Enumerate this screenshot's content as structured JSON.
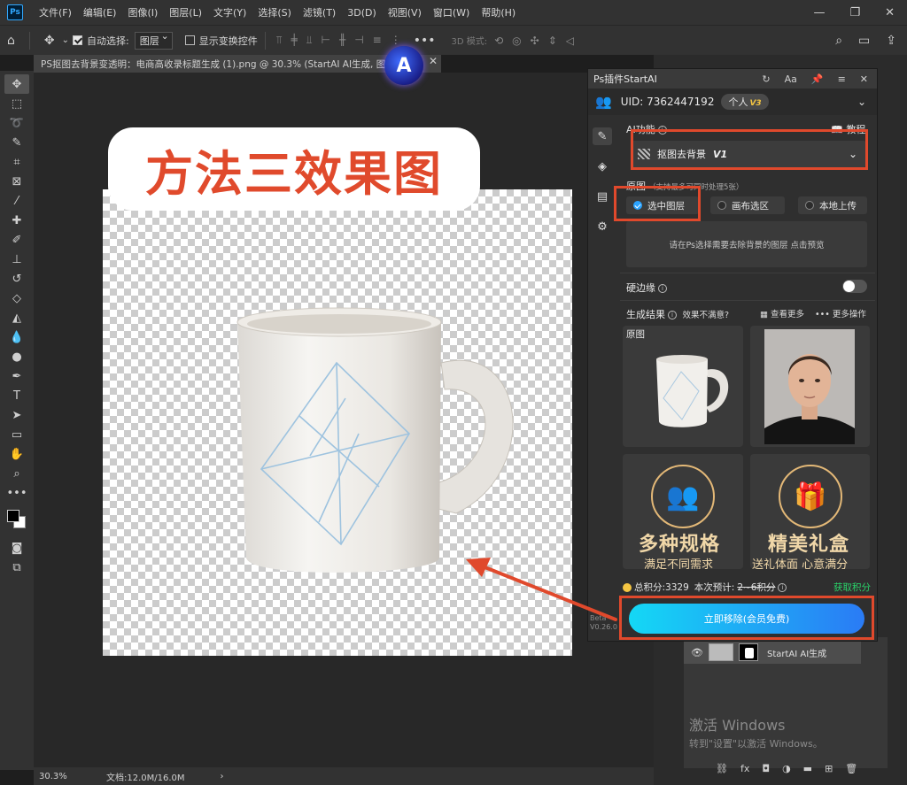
{
  "menubar": {
    "logo": "Ps",
    "items": [
      "文件(F)",
      "编辑(E)",
      "图像(I)",
      "图层(L)",
      "文字(Y)",
      "选择(S)",
      "滤镜(T)",
      "3D(D)",
      "视图(V)",
      "窗口(W)",
      "帮助(H)"
    ],
    "controls": [
      "—",
      "❐",
      "✕"
    ]
  },
  "optbar": {
    "auto_select_label": "自动选择:",
    "auto_select_value": "图层",
    "show_transform_label": "显示变换控件",
    "mode_3d": "3D 模式:"
  },
  "document": {
    "tab_title": "PS抠图去背景变透明：电商高收录标题生成 (1).png @ 30.3% (StartAI AI生成, 图层",
    "zoom": "30.3%",
    "doc_info": "文档:12.0M/16.0M",
    "overlay_title": "方法三效果图"
  },
  "plugin": {
    "title": "Ps插件StartAI",
    "uid": "UID: 7362447192",
    "plan": "个人",
    "plan_tier": "V3",
    "ai_function_label": "AI功能",
    "tutorial_label": "教程",
    "function_value": "抠图去背景",
    "function_version": "V1",
    "source_label": "原图",
    "source_note": "（支持最多可同时处理5张）",
    "source_options": [
      "选中图层",
      "画布选区",
      "本地上传"
    ],
    "hint_text": "请在Ps选择需要去除背景的图层",
    "hint_link": "点击预览",
    "hard_edge_label": "硬边缘",
    "results_label": "生成结果",
    "unsatisfied_label": "效果不满意?",
    "see_more": "查看更多",
    "more_actions": "更多操作",
    "card_original_label": "原图",
    "promo_left_big": "多种规格",
    "promo_left_small": "满足不同需求",
    "promo_right_big": "精美礼盒",
    "promo_right_small": "送礼体面  心意满分",
    "points_total": "总积分:3329",
    "points_estimate_label": "本次预计:",
    "points_estimate_value": "2~6积分",
    "get_points": "获取积分",
    "remove_button": "立即移除(会员免费)",
    "beta_label": "Beta",
    "version": "V0.26.0"
  },
  "layers": {
    "layer_name": "StartAI AI生成"
  },
  "watermark": {
    "title": "激活 Windows",
    "subtitle": "转到\"设置\"以激活 Windows。"
  },
  "colors": {
    "annotation_red": "#e0492c",
    "button_gradient_start": "#14d8f5",
    "button_gradient_end": "#2a7bf5",
    "promo_gold": "#e3b877",
    "get_points_green": "#2ad46a"
  }
}
